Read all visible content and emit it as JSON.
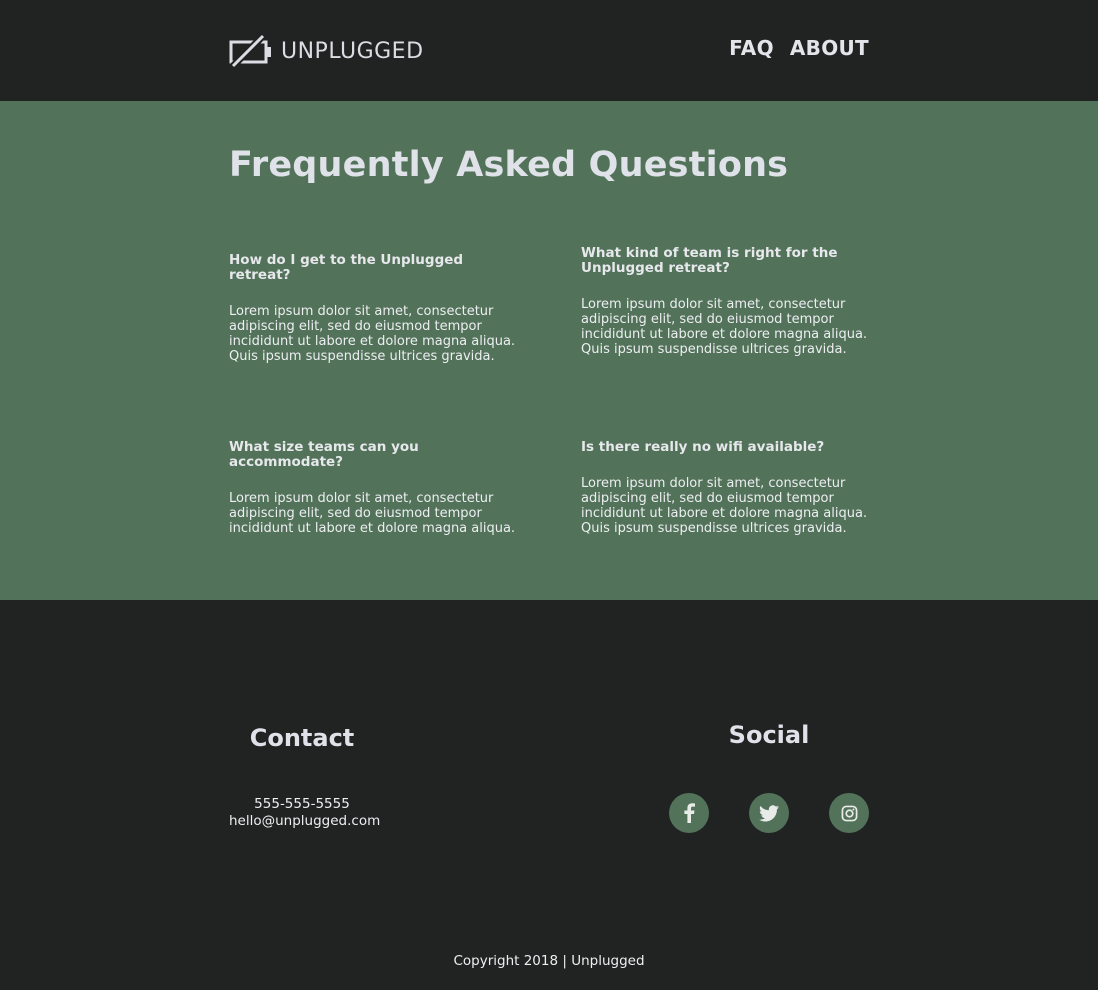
{
  "header": {
    "logo_text": "UNPLUGGED",
    "logo_icon": "unplugged-battery-icon",
    "nav": [
      {
        "label": "FAQ"
      },
      {
        "label": "ABOUT"
      }
    ]
  },
  "faq": {
    "title": "Frequently Asked Questions",
    "items": [
      {
        "question": "How do I get to the Unplugged retreat?",
        "answer": "Lorem ipsum dolor sit amet, consectetur adipiscing elit, sed do eiusmod tempor incididunt ut labore et dolore magna aliqua. Quis ipsum suspendisse ultrices gravida."
      },
      {
        "question": "What kind of team is right for the Unplugged retreat?",
        "answer": "Lorem ipsum dolor sit amet, consectetur adipiscing elit, sed do eiusmod tempor incididunt ut labore et dolore magna aliqua. Quis ipsum suspendisse ultrices gravida."
      },
      {
        "question": "What size teams can you accommodate?",
        "answer": "Lorem ipsum dolor sit amet, consectetur adipiscing elit, sed do eiusmod tempor incididunt ut labore et dolore magna aliqua."
      },
      {
        "question": "Is there really no wifi available?",
        "answer": "Lorem ipsum dolor sit amet, consectetur adipiscing elit, sed do eiusmod tempor incididunt ut labore et dolore magna aliqua. Quis ipsum suspendisse ultrices gravida."
      }
    ]
  },
  "footer": {
    "contact": {
      "title": "Contact",
      "phone": "555-555-5555",
      "email": "hello@unplugged.com"
    },
    "social": {
      "title": "Social",
      "icons": [
        "facebook-icon",
        "twitter-icon",
        "instagram-icon"
      ]
    },
    "copyright": "Copyright 2018 | Unplugged"
  },
  "colors": {
    "dark_bg": "#212222",
    "accent_green": "#53725a",
    "text_light": "#e4e5ea"
  }
}
